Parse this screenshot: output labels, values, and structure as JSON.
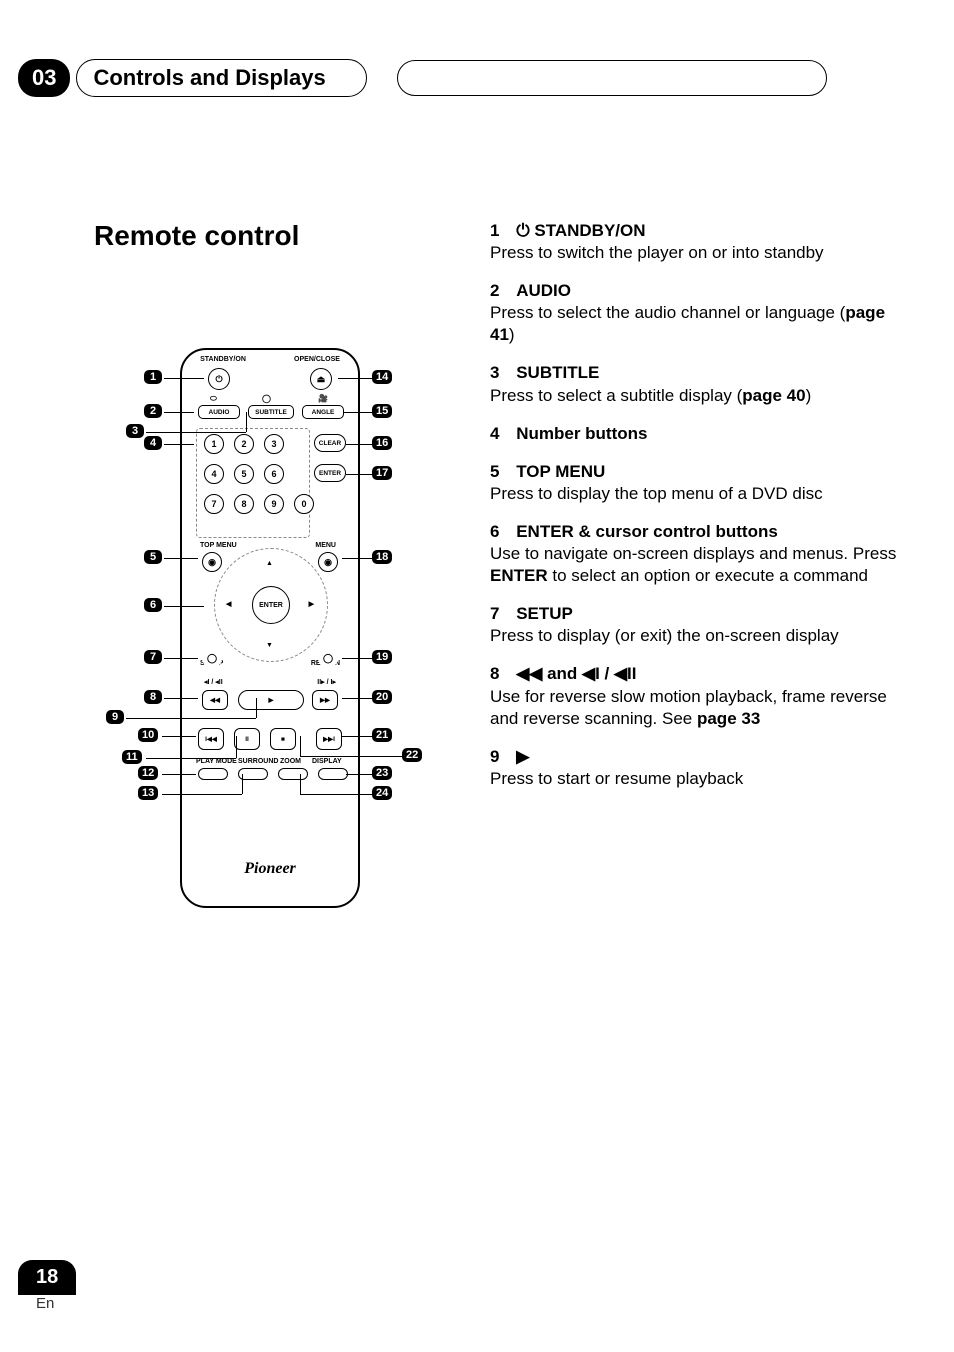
{
  "chapter": {
    "num": "03",
    "title": "Controls and Displays"
  },
  "section_heading": "Remote control",
  "remote": {
    "top_labels": {
      "standby": "STANDBY/ON",
      "open": "OPEN/CLOSE"
    },
    "row2_labels": {
      "audio": "AUDIO",
      "subtitle": "SUBTITLE",
      "angle": "ANGLE"
    },
    "numbers": [
      "1",
      "2",
      "3",
      "4",
      "5",
      "6",
      "7",
      "8",
      "9",
      "0"
    ],
    "clear": "CLEAR",
    "enter_btn": "ENTER",
    "topmenu": "TOP MENU",
    "menu": "MENU",
    "setup": "SETUP",
    "return": "RETURN",
    "scan_left": "◂I / ◂II",
    "scan_right": "II▸ / I▸",
    "bottom_row": {
      "playmode": "PLAY MODE",
      "surround": "SURROUND",
      "zoom": "ZOOM",
      "display": "DISPLAY"
    },
    "logo": "Pioneer"
  },
  "callouts_left": [
    "1",
    "2",
    "3",
    "4",
    "5",
    "6",
    "7",
    "8",
    "9",
    "10",
    "11",
    "12",
    "13"
  ],
  "callouts_right": [
    "14",
    "15",
    "16",
    "17",
    "18",
    "19",
    "20",
    "21",
    "22",
    "23",
    "24"
  ],
  "descriptions": [
    {
      "num": "1",
      "icon": "⏻",
      "title": "STANDBY/ON",
      "body": "Press to switch the player on or into standby"
    },
    {
      "num": "2",
      "title": "AUDIO",
      "body": "Press to select the audio channel or language (",
      "page": "page 41",
      "closing": ")"
    },
    {
      "num": "3",
      "title": "SUBTITLE",
      "body": "Press to select a subtitle display (",
      "page": "page 40",
      "closing": ")"
    },
    {
      "num": "4",
      "title": "Number buttons",
      "body": ""
    },
    {
      "num": "5",
      "title": "TOP MENU",
      "body": "Press to display the top menu of a DVD disc"
    },
    {
      "num": "6",
      "title": "ENTER & cursor control buttons",
      "body_pre": "Use to navigate on-screen displays and menus. Press ",
      "bold": "ENTER",
      "body_post": " to select an option or execute a command"
    },
    {
      "num": "7",
      "title": "SETUP",
      "body": "Press to display (or exit) the on-screen display"
    },
    {
      "num": "8",
      "title": "◀◀ and ◀I / ◀II",
      "body_pre": "Use for reverse slow motion playback, frame reverse and reverse scanning. See ",
      "page": "page 33"
    },
    {
      "num": "9",
      "title": "▶",
      "body": "Press to start or resume playback"
    }
  ],
  "footer": {
    "page": "18",
    "lang": "En"
  }
}
